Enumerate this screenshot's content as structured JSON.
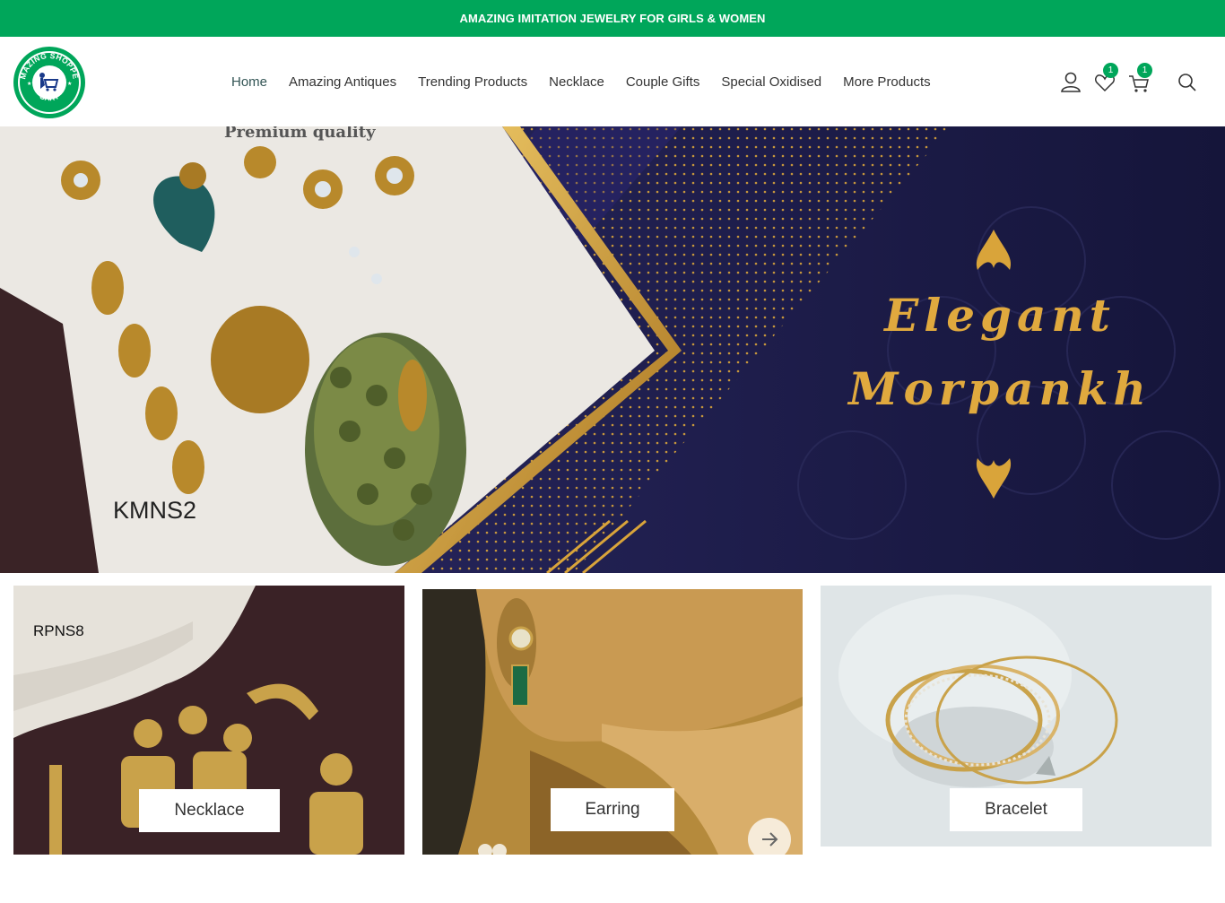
{
  "announcement": "AMAZING IMITATION JEWELRY FOR GIRLS & WOMEN",
  "brand": {
    "logo_ring_text": "AMAZING SHOPPER",
    "logo_bottom_text": "CART",
    "color": "#00a65a"
  },
  "nav": {
    "items": [
      {
        "label": "Home",
        "active": true
      },
      {
        "label": "Amazing Antiques"
      },
      {
        "label": "Trending Products"
      },
      {
        "label": "Necklace"
      },
      {
        "label": "Couple Gifts"
      },
      {
        "label": "Special Oxidised"
      },
      {
        "label": "More Products"
      }
    ]
  },
  "header_icons": {
    "account": "user-icon",
    "wishlist": "heart-icon",
    "wishlist_count": "1",
    "cart": "cart-icon",
    "cart_count": "1",
    "search": "search-icon"
  },
  "hero": {
    "top_text": "Premium quality",
    "product_code": "KMNS2",
    "headline_line1": "Elegant",
    "headline_line2": "Morpankh",
    "bg_color": "#1a1a44",
    "accent_color": "#d9a43a"
  },
  "categories": [
    {
      "label": "Necklace",
      "code": "RPNS8"
    },
    {
      "label": "Earring"
    },
    {
      "label": "Bracelet"
    }
  ],
  "carousel_next": "arrow-right-icon"
}
